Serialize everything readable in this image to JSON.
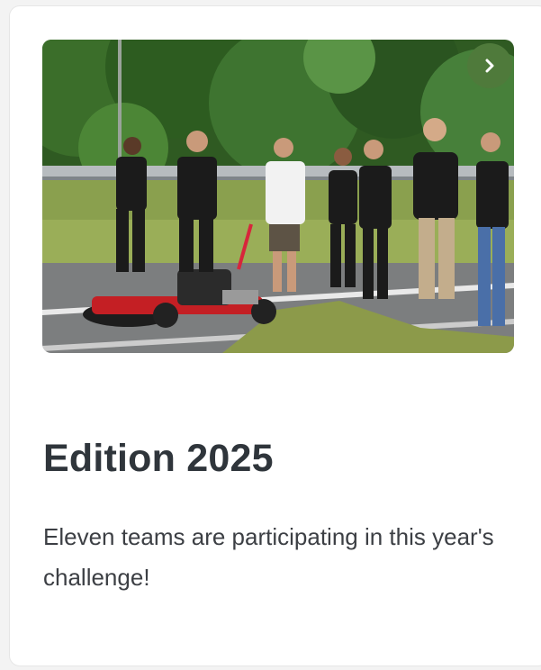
{
  "card": {
    "image_alt": "Team walking beside a go-kart on a test track",
    "next_button": {
      "icon": "chevron-right-icon",
      "color": "#4f7a3b"
    },
    "title": "Edition 2025",
    "description": "Eleven teams are participating in this year's challenge!"
  }
}
